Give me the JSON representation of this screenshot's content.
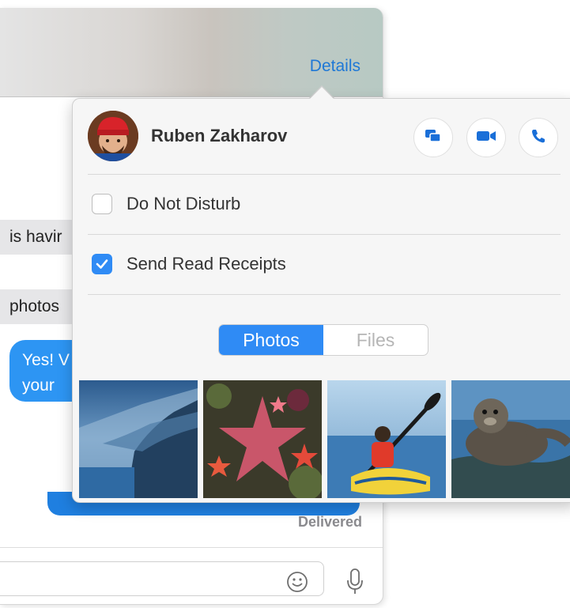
{
  "window": {
    "details_label": "Details",
    "messages": [
      {
        "text": "is havir"
      },
      {
        "text": "photos"
      }
    ],
    "sent_bubble": {
      "line1": "Yes! V",
      "line2": "your"
    },
    "status": "Delivered",
    "icons": {
      "emoji": "smiley-face-icon",
      "mic": "microphone-icon"
    }
  },
  "popover": {
    "contact": {
      "name": "Ruben Zakharov"
    },
    "actions": [
      {
        "icon": "message-bubbles-icon"
      },
      {
        "icon": "video-camera-icon"
      },
      {
        "icon": "phone-icon"
      }
    ],
    "options": [
      {
        "label": "Do Not Disturb",
        "checked": false
      },
      {
        "label": "Send Read Receipts",
        "checked": true
      }
    ],
    "segments": [
      {
        "label": "Photos",
        "selected": true
      },
      {
        "label": "Files",
        "selected": false
      }
    ],
    "accent_color": "#2f8bf5"
  }
}
